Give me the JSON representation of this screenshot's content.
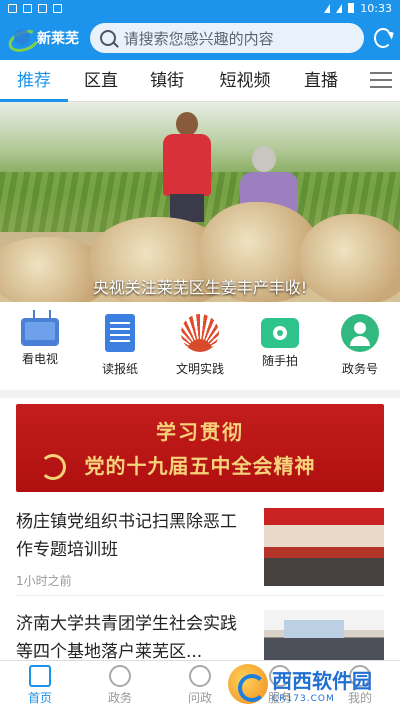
{
  "status_bar": {
    "time": "10:33"
  },
  "header": {
    "app_name": "新莱芜",
    "search_placeholder": "请搜索您感兴趣的内容",
    "refresh_icon": "refresh-icon"
  },
  "tabs": [
    {
      "label": "推荐",
      "active": true
    },
    {
      "label": "区直",
      "active": false
    },
    {
      "label": "镇街",
      "active": false
    },
    {
      "label": "短视频",
      "active": false
    },
    {
      "label": "直播",
      "active": false
    }
  ],
  "banner": {
    "caption": "央视关注莱芜区生姜丰产丰收!"
  },
  "quick_links": [
    {
      "label": "看电视",
      "icon": "tv-icon"
    },
    {
      "label": "读报纸",
      "icon": "newspaper-icon"
    },
    {
      "label": "文明实践",
      "icon": "civilization-icon"
    },
    {
      "label": "随手拍",
      "icon": "camera-icon"
    },
    {
      "label": "政务号",
      "icon": "gov-account-icon"
    }
  ],
  "promo": {
    "line1": "学习贯彻",
    "line2": "党的十九届五中全会精神"
  },
  "news": [
    {
      "title": "杨庄镇党组织书记扫黑除恶工作专题培训班",
      "time": "1小时之前"
    },
    {
      "title": "济南大学共青团学生社会实践等四个基地落户莱芜区...",
      "time": ""
    }
  ],
  "bottom_nav": [
    {
      "label": "首页",
      "active": true
    },
    {
      "label": "政务",
      "active": false
    },
    {
      "label": "问政",
      "active": false
    },
    {
      "label": "服务",
      "active": false
    },
    {
      "label": "我的",
      "active": false
    }
  ],
  "watermark": {
    "main": "西西软件园",
    "sub": "CR173.COM"
  },
  "colors": {
    "primary": "#1d94ec",
    "promo_red": "#c41d1d",
    "promo_gold": "#f6d27a"
  }
}
